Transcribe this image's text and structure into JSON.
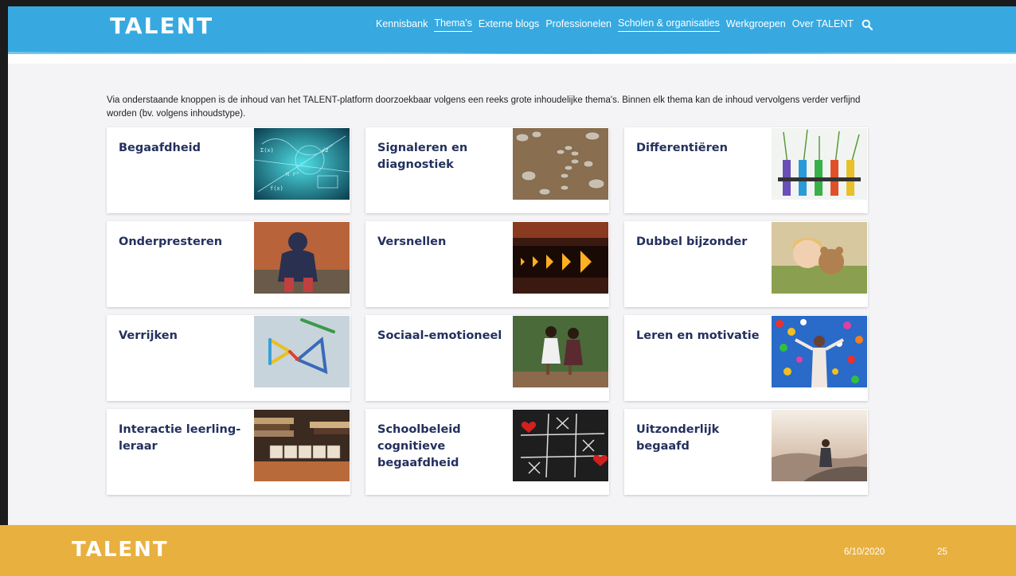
{
  "header": {
    "logo": "TALENT",
    "nav": [
      {
        "label": "Kennisbank",
        "active": false
      },
      {
        "label": "Thema's",
        "active": true
      },
      {
        "label": "Externe blogs",
        "active": false
      },
      {
        "label": "Professionelen",
        "active": false
      },
      {
        "label": "Scholen & organisaties",
        "active": true
      },
      {
        "label": "Werkgroepen",
        "active": false
      },
      {
        "label": "Over TALENT",
        "active": false
      }
    ],
    "search_icon": "search-icon",
    "colors": {
      "bar": "#37a9e0",
      "text": "#ffffff"
    }
  },
  "intro": "Via onderstaande knoppen is de inhoud van het TALENT-platform doorzoekbaar volgens een reeks grote inhoudelijke thema's. Binnen elk thema kan de inhoud vervolgens verder verfijnd worden (bv. volgens inhoudstype).",
  "themes": [
    {
      "title": "Begaafdheid",
      "image": "math-formulas-photo"
    },
    {
      "title": "Signaleren en diagnostiek",
      "image": "pebbles-question-mark-photo"
    },
    {
      "title": "Differentiëren",
      "image": "test-tubes-flowers-photo"
    },
    {
      "title": "Onderpresteren",
      "image": "sad-child-against-wall-photo"
    },
    {
      "title": "Versnellen",
      "image": "led-arrows-photo"
    },
    {
      "title": "Dubbel bijzonder",
      "image": "child-with-teddy-bear-photo"
    },
    {
      "title": "Verrijken",
      "image": "pencils-triangles-photo"
    },
    {
      "title": "Sociaal-emotioneel",
      "image": "two-girls-walking-photo"
    },
    {
      "title": "Leren en motivatie",
      "image": "girl-with-balloons-photo"
    },
    {
      "title": "Interactie leerling-leraar",
      "image": "teach-letter-blocks-photo"
    },
    {
      "title": "Schoolbeleid cognitieve begaafdheid",
      "image": "tic-tac-toe-hearts-photo"
    },
    {
      "title": "Uitzonderlijk begaafd",
      "image": "person-on-mountain-photo"
    }
  ],
  "footer": {
    "logo": "TALENT",
    "date": "6/10/2020",
    "page": "25",
    "color": "#e8b03f"
  }
}
